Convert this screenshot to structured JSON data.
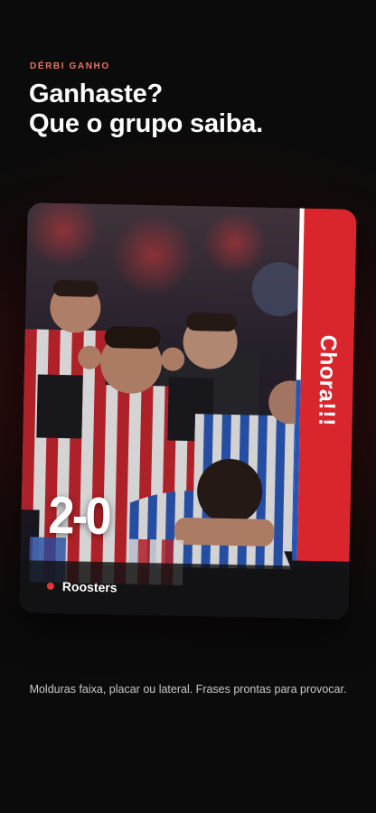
{
  "header": {
    "eyebrow": "DÉRBI GANHO",
    "headline_line1": "Ganhaste?",
    "headline_line2": "Que o grupo saiba."
  },
  "card": {
    "side_banner_text": "Chora!!!",
    "score": "2-0",
    "team_name": "Roosters",
    "colors": {
      "banner_red": "#d8262c",
      "banner_blue": "#2355b8",
      "dot": "#e0363a"
    }
  },
  "caption": "Molduras faixa, placar ou lateral. Frases prontas para provocar."
}
